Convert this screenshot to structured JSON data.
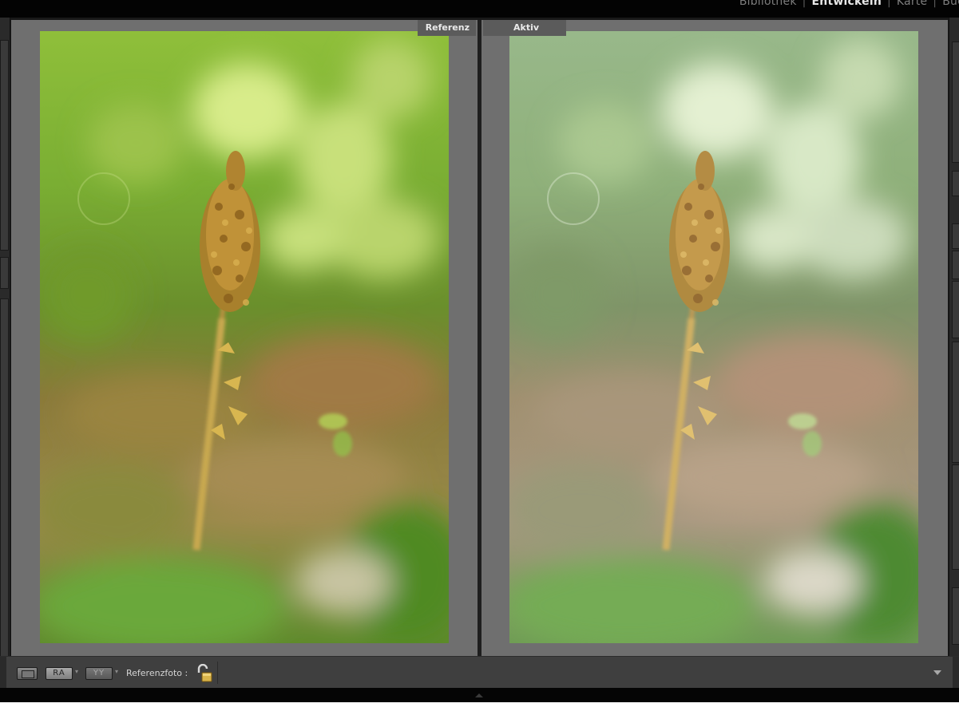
{
  "modules": {
    "items": [
      "Bibliothek",
      "Entwickeln",
      "Karte",
      "Buc"
    ],
    "active": "Entwickeln",
    "separator": "|"
  },
  "compare": {
    "left_label": "Referenz",
    "right_label": "Aktiv"
  },
  "toolbar": {
    "view_ra": "RA",
    "view_yy": "YY",
    "reference_label": "Referenzfoto :",
    "icons": [
      "single-view-icon",
      "reference-active-view-icon",
      "before-after-view-icon",
      "lock-open-icon",
      "dropdown-arrow-icon"
    ]
  },
  "colors": {
    "app_bg": "#181818",
    "pane_bg": "#6f6f6f",
    "toolbar_bg": "#3f3f3f",
    "active_module": "#e8e8e8",
    "inactive_module": "#7d7d7d"
  }
}
